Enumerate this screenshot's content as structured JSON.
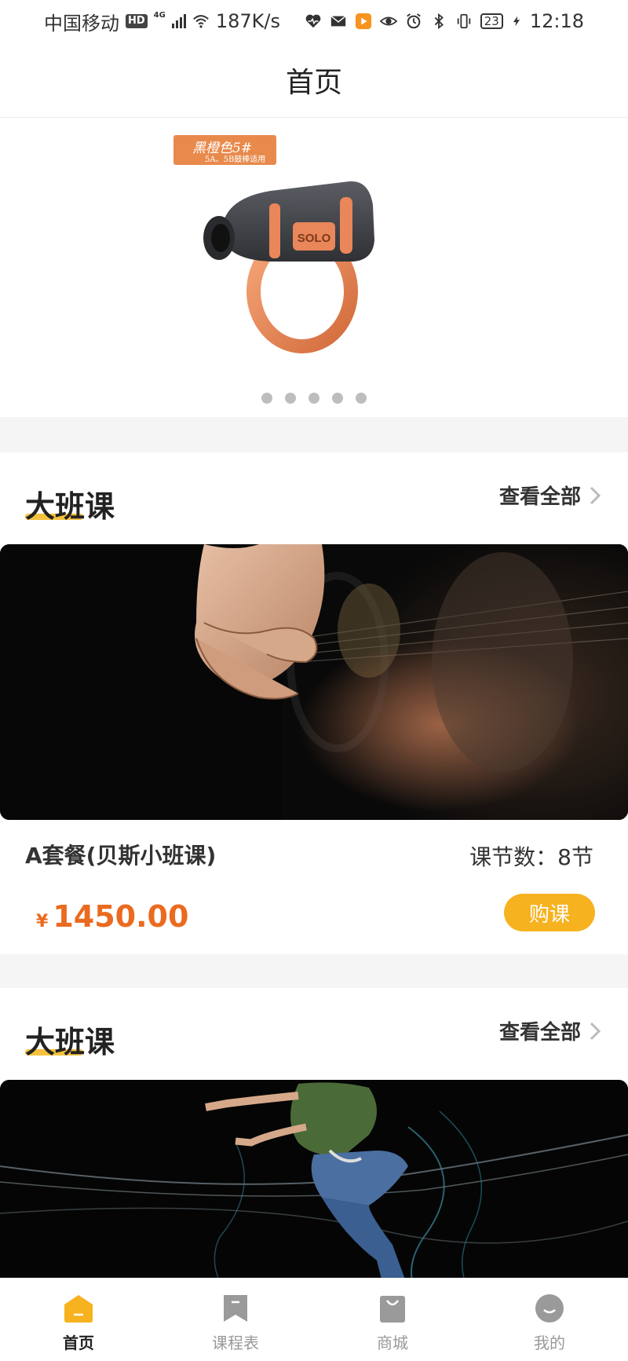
{
  "status_bar": {
    "carrier": "中国移动",
    "hd": "HD",
    "network": "4G",
    "speed": "187K/s",
    "battery": "23",
    "time": "12:18"
  },
  "nav": {
    "title": "首页"
  },
  "banner": {
    "tag_title": "黑橙色5#",
    "tag_subtitle": "5A、5B鼓棒适用",
    "product_text": "SOLO",
    "dot_count": 5
  },
  "sections": [
    {
      "title": "大班课",
      "view_all": "查看全部",
      "course_name": "A套餐(贝斯小班课)",
      "lessons": "课节数：8节",
      "currency": "¥",
      "price": "1450.00",
      "buy_label": "购课"
    },
    {
      "title": "大班课",
      "view_all": "查看全部"
    }
  ],
  "tabs": [
    {
      "label": "首页",
      "icon": "home-icon",
      "active": true
    },
    {
      "label": "课程表",
      "icon": "bookmark-icon",
      "active": false
    },
    {
      "label": "商城",
      "icon": "shopping-bag-icon",
      "active": false
    },
    {
      "label": "我的",
      "icon": "profile-icon",
      "active": false
    }
  ],
  "colors": {
    "accent": "#f7b21f",
    "price": "#ea6a1f",
    "tag": "#e88a4c"
  }
}
